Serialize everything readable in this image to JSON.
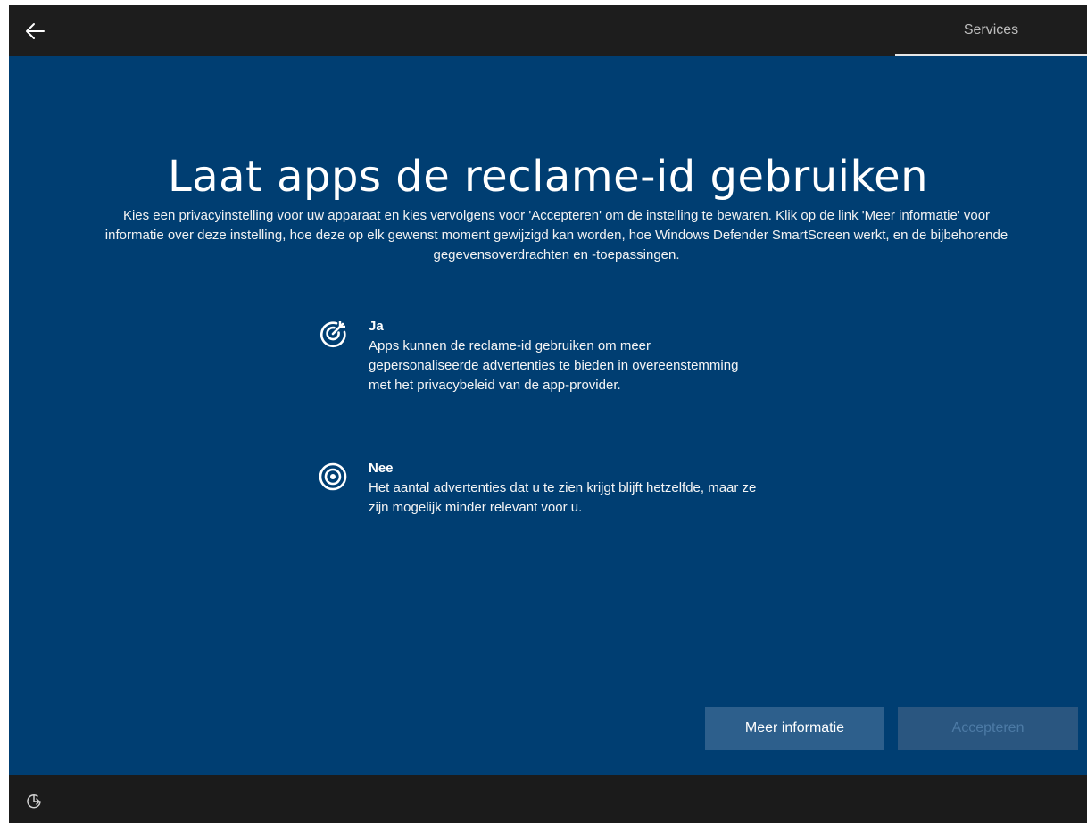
{
  "topbar": {
    "back_icon": "arrow-left-icon",
    "section_tab": "Services"
  },
  "page": {
    "title": "Laat apps de reclame-id gebruiken",
    "intro": "Kies een privacyinstelling voor uw apparaat en kies vervolgens voor 'Accepteren' om de instelling te bewaren. Klik op de link 'Meer informatie' voor informatie over deze instelling, hoe deze op elk gewenst moment gewijzigd kan worden, hoe Windows Defender SmartScreen werkt, en de bijbehorende gegevensoverdrachten en -toepassingen."
  },
  "options": [
    {
      "label": "Ja",
      "description": "Apps kunnen de reclame-id gebruiken om meer gepersonaliseerde advertenties te bieden in overeenstemming met het privacybeleid van de app-provider.",
      "icon": "target-arrow-icon"
    },
    {
      "label": "Nee",
      "description": "Het aantal advertenties dat u te zien krijgt blijft hetzelfde, maar ze zijn mogelijk minder relevant voor u.",
      "icon": "target-icon"
    }
  ],
  "buttons": {
    "more_info": "Meer informatie",
    "accept": "Accepteren"
  },
  "bottombar": {
    "accessibility_icon": "ease-of-access-icon"
  },
  "colors": {
    "main_background": "#003e72",
    "bar_background": "#1d1d1d",
    "button_primary": "#2d5f8c",
    "button_disabled_text": "#4c7aa5"
  }
}
